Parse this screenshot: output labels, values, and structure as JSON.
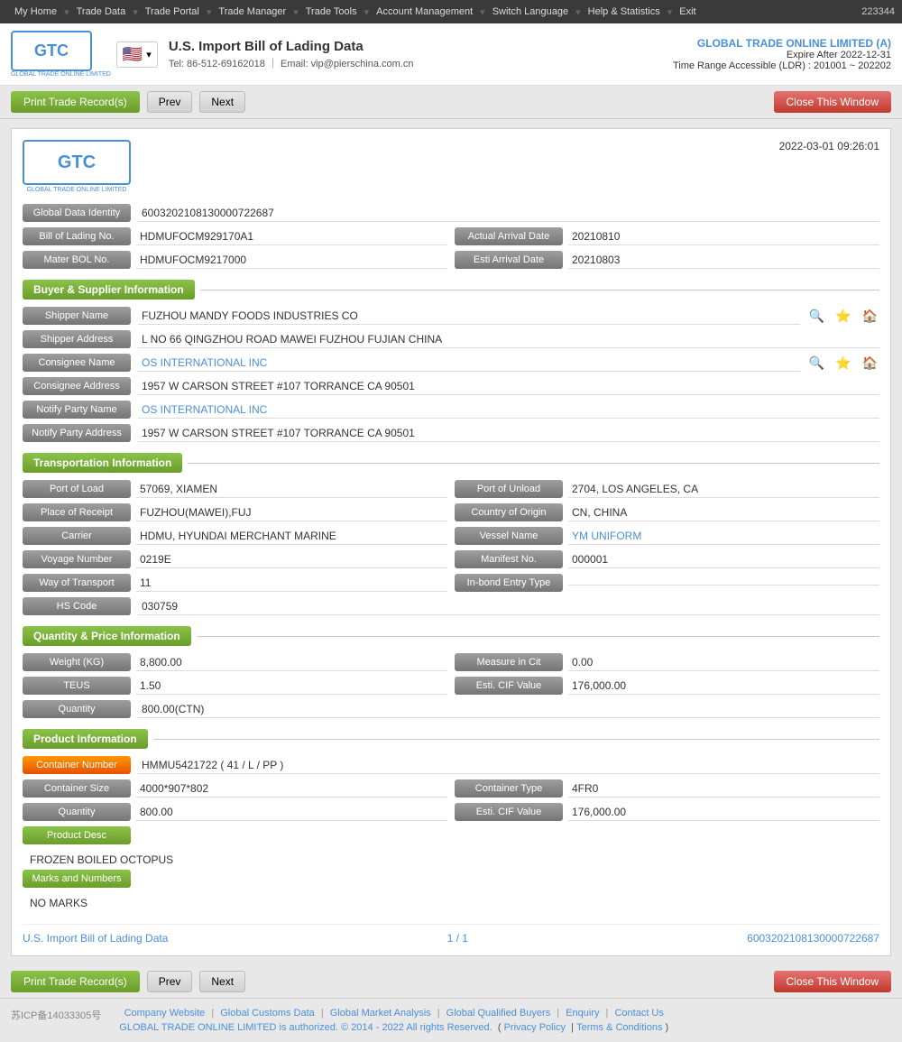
{
  "nav": {
    "items": [
      "My Home",
      "Trade Data",
      "Trade Portal",
      "Trade Manager",
      "Trade Tools",
      "Account Management",
      "Switch Language",
      "Help & Statistics",
      "Exit"
    ],
    "account": "223344"
  },
  "header": {
    "logo_text": "GTC",
    "logo_sub": "GLOBAL TRADE ONLINE LIMITED",
    "flag_emoji": "🇺🇸",
    "title": "U.S. Import Bill of Lading Data",
    "contact_tel": "Tel: 86-512-69162018",
    "contact_email": "Email: vip@pierschina.com.cn",
    "company": "GLOBAL TRADE ONLINE LIMITED (A)",
    "expiry": "Expire After 2022-12-31",
    "range": "Time Range Accessible (LDR) : 201001 ~ 202202"
  },
  "toolbar": {
    "print_label": "Print Trade Record(s)",
    "prev_label": "Prev",
    "next_label": "Next",
    "close_label": "Close This Window"
  },
  "record": {
    "logo_text": "GTC",
    "logo_sub": "GLOBAL TRADE ONLINE LIMITED",
    "date": "2022-03-01 09:26:01",
    "global_data_identity_label": "Global Data Identity",
    "global_data_identity": "6003202108130000722687",
    "bill_of_lading_label": "Bill of Lading No.",
    "bill_of_lading": "HDMUFOCM929170A1",
    "actual_arrival_date_label": "Actual Arrival Date",
    "actual_arrival_date": "20210810",
    "mater_bol_label": "Mater BOL No.",
    "mater_bol": "HDMUFOCM9217000",
    "esti_arrival_label": "Esti Arrival Date",
    "esti_arrival": "20210803",
    "buyer_supplier_section": "Buyer & Supplier Information",
    "shipper_name_label": "Shipper Name",
    "shipper_name": "FUZHOU MANDY FOODS INDUSTRIES CO",
    "shipper_address_label": "Shipper Address",
    "shipper_address": "L NO 66 QINGZHOU ROAD MAWEI FUZHOU FUJIAN CHINA",
    "consignee_name_label": "Consignee Name",
    "consignee_name": "OS INTERNATIONAL INC",
    "consignee_address_label": "Consignee Address",
    "consignee_address": "1957 W CARSON STREET #107 TORRANCE CA 90501",
    "notify_party_name_label": "Notify Party Name",
    "notify_party_name": "OS INTERNATIONAL INC",
    "notify_party_address_label": "Notify Party Address",
    "notify_party_address": "1957 W CARSON STREET #107 TORRANCE CA 90501",
    "transport_section": "Transportation Information",
    "port_of_load_label": "Port of Load",
    "port_of_load": "57069, XIAMEN",
    "port_of_unload_label": "Port of Unload",
    "port_of_unload": "2704, LOS ANGELES, CA",
    "place_of_receipt_label": "Place of Receipt",
    "place_of_receipt": "FUZHOU(MAWEI),FUJ",
    "country_of_origin_label": "Country of Origin",
    "country_of_origin": "CN, CHINA",
    "carrier_label": "Carrier",
    "carrier": "HDMU, HYUNDAI MERCHANT MARINE",
    "vessel_name_label": "Vessel Name",
    "vessel_name": "YM UNIFORM",
    "voyage_number_label": "Voyage Number",
    "voyage_number": "0219E",
    "manifest_no_label": "Manifest No.",
    "manifest_no": "000001",
    "way_of_transport_label": "Way of Transport",
    "way_of_transport": "11",
    "in_bond_entry_label": "In-bond Entry Type",
    "in_bond_entry": "",
    "hs_code_label": "HS Code",
    "hs_code": "030759",
    "qty_price_section": "Quantity & Price Information",
    "weight_kg_label": "Weight (KG)",
    "weight_kg": "8,800.00",
    "measure_in_cit_label": "Measure in Cit",
    "measure_in_cit": "0.00",
    "teus_label": "TEUS",
    "teus": "1.50",
    "esti_cif_label": "Esti. CIF Value",
    "esti_cif": "176,000.00",
    "quantity_label": "Quantity",
    "quantity": "800.00(CTN)",
    "product_section": "Product Information",
    "container_number_label": "Container Number",
    "container_number": "HMMU5421722 ( 41 / L / PP )",
    "container_size_label": "Container Size",
    "container_size": "4000*907*802",
    "container_type_label": "Container Type",
    "container_type": "4FR0",
    "qty_label": "Quantity",
    "qty_value": "800.00",
    "esti_cif2_label": "Esti. CIF Value",
    "esti_cif2": "176,000.00",
    "product_desc_label": "Product Desc",
    "product_desc": "FROZEN BOILED OCTOPUS",
    "marks_label": "Marks and Numbers",
    "marks_value": "NO MARKS",
    "footer_source": "U.S. Import Bill of Lading Data",
    "footer_page": "1 / 1",
    "footer_id": "6003202108130000722687"
  },
  "footer": {
    "icp": "苏ICP备14033305号",
    "links": [
      "Company Website",
      "Global Customs Data",
      "Global Market Analysis",
      "Global Qualified Buyers",
      "Enquiry",
      "Contact Us"
    ],
    "copy": "GLOBAL TRADE ONLINE LIMITED is authorized. © 2014 - 2022 All rights Reserved.",
    "privacy": "Privacy Policy",
    "terms": "Terms & Conditions"
  }
}
